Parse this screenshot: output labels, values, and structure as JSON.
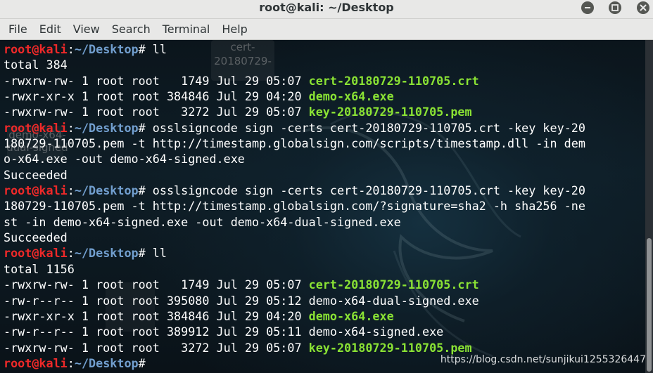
{
  "window": {
    "title": "root@kali: ~/Desktop"
  },
  "menu": [
    "File",
    "Edit",
    "View",
    "Search",
    "Terminal",
    "Help"
  ],
  "prompt": {
    "user": "root@kali",
    "sep": ":",
    "path": "~/Desktop",
    "symbol": "# "
  },
  "desktop_icons": [
    {
      "label_line1": "cert-",
      "label_line2": "20180729-"
    },
    {
      "label_line1": "demo-x64-",
      "label_line2": "dual-signed"
    }
  ],
  "lines": [
    {
      "type": "prompt",
      "cmd": "ll"
    },
    {
      "type": "out",
      "text": "total 384"
    },
    {
      "type": "ls",
      "meta": "-rwxrw-rw- 1 root root   1749 Jul 29 05:07 ",
      "name": "cert-20180729-110705.crt",
      "hl": true
    },
    {
      "type": "ls",
      "meta": "-rwxr-xr-x 1 root root 384846 Jul 29 04:20 ",
      "name": "demo-x64.exe",
      "hl": true
    },
    {
      "type": "ls",
      "meta": "-rwxrw-rw- 1 root root   3272 Jul 29 05:07 ",
      "name": "key-20180729-110705.pem",
      "hl": true
    },
    {
      "type": "prompt",
      "cmd": "osslsigncode sign -certs cert-20180729-110705.crt -key key-20"
    },
    {
      "type": "out",
      "text": "180729-110705.pem -t http://timestamp.globalsign.com/scripts/timestamp.dll -in dem"
    },
    {
      "type": "out",
      "text": "o-x64.exe -out demo-x64-signed.exe"
    },
    {
      "type": "out",
      "text": "Succeeded"
    },
    {
      "type": "prompt",
      "cmd": "osslsigncode sign -certs cert-20180729-110705.crt -key key-20"
    },
    {
      "type": "out",
      "text": "180729-110705.pem -t http://timestamp.globalsign.com/?signature=sha2 -h sha256 -ne"
    },
    {
      "type": "out",
      "text": "st -in demo-x64-signed.exe -out demo-x64-dual-signed.exe"
    },
    {
      "type": "out",
      "text": "Succeeded"
    },
    {
      "type": "prompt",
      "cmd": "ll"
    },
    {
      "type": "out",
      "text": "total 1156"
    },
    {
      "type": "ls",
      "meta": "-rwxrw-rw- 1 root root   1749 Jul 29 05:07 ",
      "name": "cert-20180729-110705.crt",
      "hl": true
    },
    {
      "type": "ls",
      "meta": "-rw-r--r-- 1 root root 395080 Jul 29 05:12 ",
      "name": "demo-x64-dual-signed.exe",
      "hl": false
    },
    {
      "type": "ls",
      "meta": "-rwxr-xr-x 1 root root 384846 Jul 29 04:20 ",
      "name": "demo-x64.exe",
      "hl": true
    },
    {
      "type": "ls",
      "meta": "-rw-r--r-- 1 root root 389912 Jul 29 05:11 ",
      "name": "demo-x64-signed.exe",
      "hl": false
    },
    {
      "type": "ls",
      "meta": "-rwxrw-rw- 1 root root   3272 Jul 29 05:07 ",
      "name": "key-20180729-110705.pem",
      "hl": true
    },
    {
      "type": "prompt",
      "cmd": ""
    }
  ],
  "watermark": "https://blog.csdn.net/sunjikui1255326447",
  "colors": {
    "prompt_user": "#ef2929",
    "prompt_path": "#729fcf",
    "executable_file": "#8ae234",
    "text": "#ffffff"
  }
}
